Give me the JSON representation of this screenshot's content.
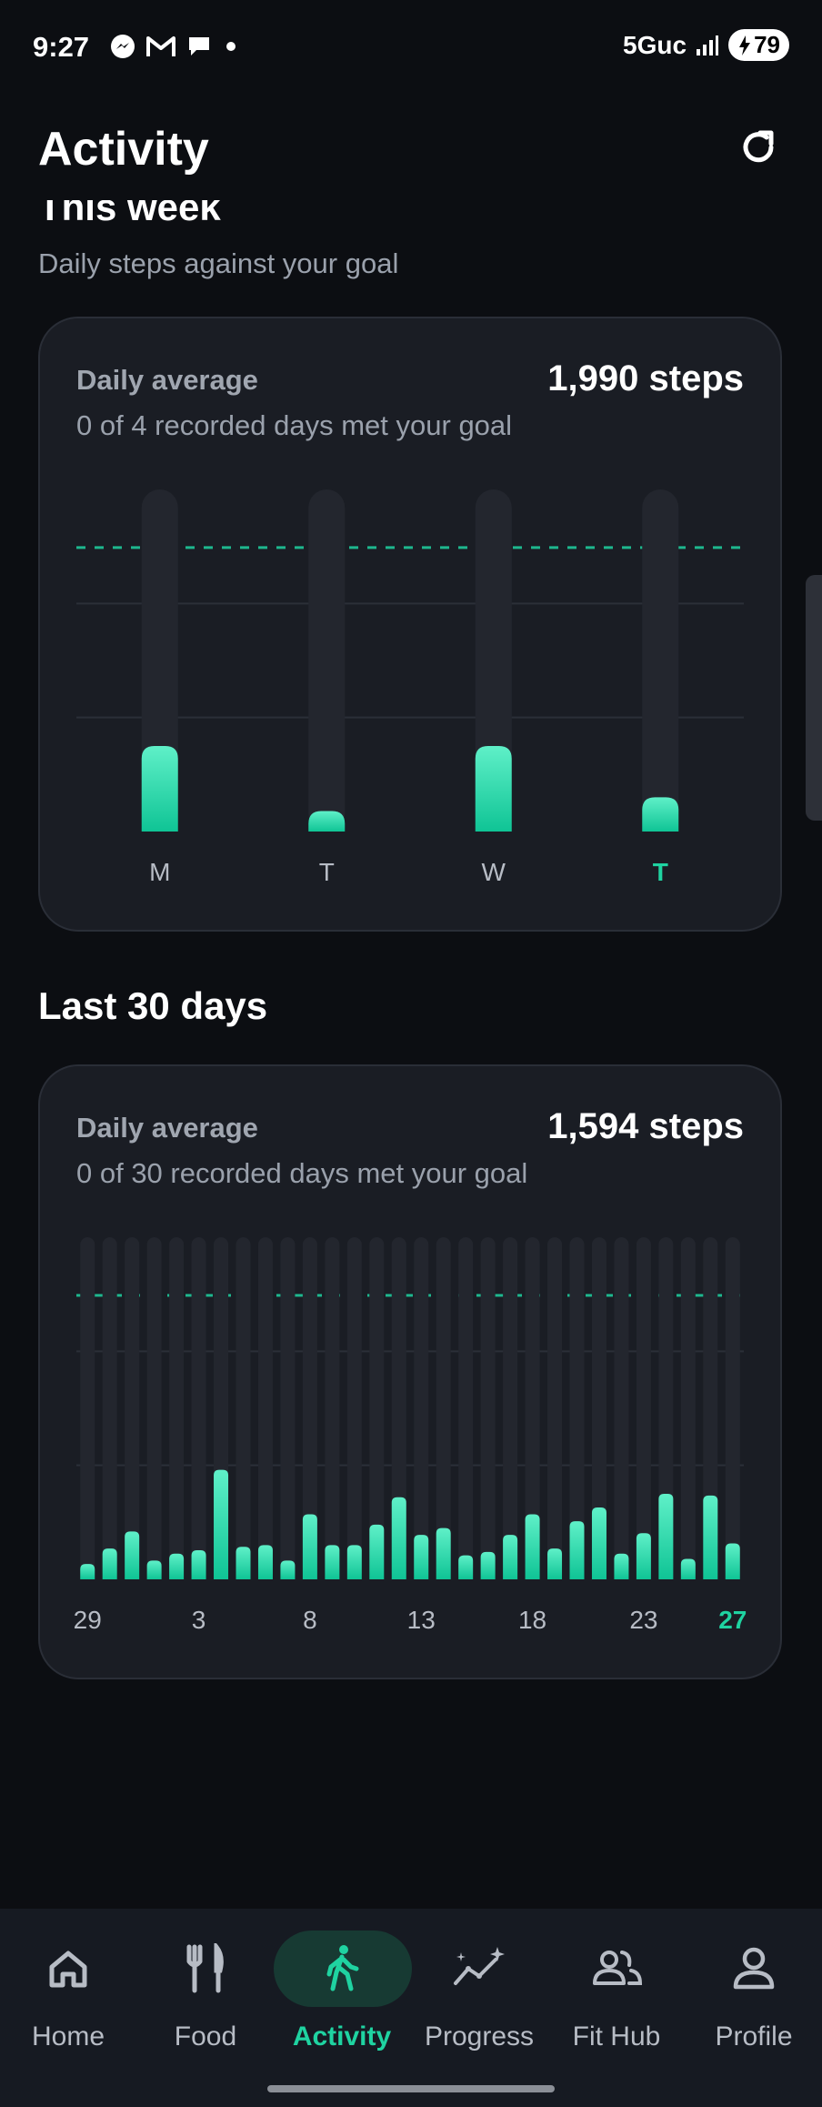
{
  "status": {
    "time": "9:27",
    "network": "5Guc",
    "battery": "79"
  },
  "header": {
    "title": "Activity"
  },
  "this_week": {
    "title": "This week",
    "subtitle": "Daily steps against your goal",
    "label": "Daily average",
    "value": "1,990 steps",
    "summary": "0 of 4 recorded days met your goal"
  },
  "last30": {
    "title": "Last 30 days",
    "label": "Daily average",
    "value": "1,594 steps",
    "summary": "0 of 30 recorded days met your goal"
  },
  "colors": {
    "accent": "#1fd3a1",
    "background": "#0c0e12",
    "card": "#1a1d24"
  },
  "chart_data": [
    {
      "type": "bar",
      "categories": [
        "M",
        "T",
        "W",
        "T"
      ],
      "values": [
        0.25,
        0.06,
        0.25,
        0.1
      ],
      "goal_line": 0.83,
      "highlight_last": true,
      "grid": true
    },
    {
      "type": "bar",
      "categories": [
        "29",
        "30",
        "31",
        "1",
        "2",
        "3",
        "4",
        "5",
        "6",
        "7",
        "8",
        "9",
        "10",
        "11",
        "12",
        "13",
        "14",
        "15",
        "16",
        "17",
        "18",
        "19",
        "20",
        "21",
        "22",
        "23",
        "24",
        "25",
        "26",
        "27"
      ],
      "tick_labels": [
        "29",
        "3",
        "8",
        "13",
        "18",
        "23",
        "27"
      ],
      "values": [
        0.045,
        0.09,
        0.14,
        0.055,
        0.075,
        0.085,
        0.32,
        0.095,
        0.1,
        0.055,
        0.19,
        0.1,
        0.1,
        0.16,
        0.24,
        0.13,
        0.15,
        0.07,
        0.08,
        0.13,
        0.19,
        0.09,
        0.17,
        0.21,
        0.075,
        0.135,
        0.25,
        0.06,
        0.245,
        0.105
      ],
      "goal_line": 0.83,
      "highlight_last": true,
      "grid": true
    }
  ],
  "nav": [
    {
      "label": "Home",
      "icon": "home-icon"
    },
    {
      "label": "Food",
      "icon": "fork-knife-icon"
    },
    {
      "label": "Activity",
      "icon": "walking-icon",
      "active": true
    },
    {
      "label": "Progress",
      "icon": "trend-sparkle-icon"
    },
    {
      "label": "Fit Hub",
      "icon": "group-icon"
    },
    {
      "label": "Profile",
      "icon": "person-icon"
    }
  ]
}
